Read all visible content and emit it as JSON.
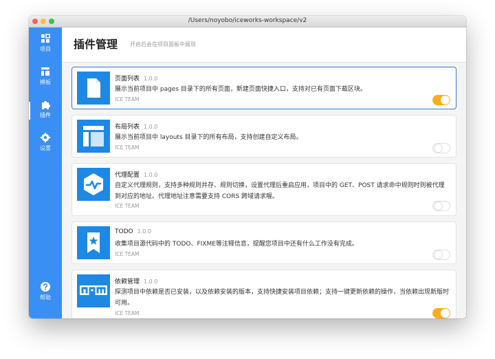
{
  "window": {
    "title": "/Users/noyobo/iceworks-workspace/v2"
  },
  "sidebar": {
    "items": [
      {
        "label": "项目",
        "icon": "projects-icon"
      },
      {
        "label": "模板",
        "icon": "templates-icon"
      },
      {
        "label": "插件",
        "icon": "puzzle-icon",
        "active": true
      },
      {
        "label": "设置",
        "icon": "gear-icon"
      }
    ],
    "help": {
      "label": "帮助",
      "icon": "help-icon"
    }
  },
  "header": {
    "title": "插件管理",
    "subtitle": "开启后会在项目面板中展现"
  },
  "colors": {
    "sidebar": "#3a8ff5",
    "icon_bg": "#1e88e5",
    "toggle_on": "#fcaa1e",
    "selected_border": "#3a73d8"
  },
  "plugins": [
    {
      "name": "页面列表",
      "version": "1.0.0",
      "description": "展示当前项目中 pages 目录下的所有页面，新建页面快捷入口，支持对已有页面下载区块。",
      "team": "ICE TEAM",
      "enabled": true,
      "icon": "file-icon"
    },
    {
      "name": "布局列表",
      "version": "1.0.0",
      "description": "展示当前项目中 layouts 目录下的所有布局，支持创建自定义布局。",
      "team": "ICE TEAM",
      "enabled": false,
      "icon": "layout-icon"
    },
    {
      "name": "代理配置",
      "version": "1.0.0",
      "description": "自定义代理规则，支持多种规则并存、规则切换，设置代理后重启应用，项目中的 GET、POST 请求命中规则时则被代理到对应的地址。代理地址注意需要支持 CORS 跨域请求喔。",
      "team": "ICE TEAM",
      "enabled": false,
      "icon": "proxy-pulse-icon"
    },
    {
      "name": "TODO",
      "version": "1.0.0",
      "description": "收集项目源代码中的 TODO、FIXME等注释信息，提醒您项目中还有什么工作没有完成。",
      "team": "ICE TEAM",
      "enabled": false,
      "icon": "bookmark-star-icon"
    },
    {
      "name": "依赖管理",
      "version": "1.0.0",
      "description": "探测项目中依赖是否已安装，以及依赖安装的版本，支持快捷安装项目依赖；支持一键更新依赖的操作，当依赖出现新版时可用。",
      "team": "ICE TEAM",
      "enabled": true,
      "icon": "npm-icon"
    }
  ]
}
